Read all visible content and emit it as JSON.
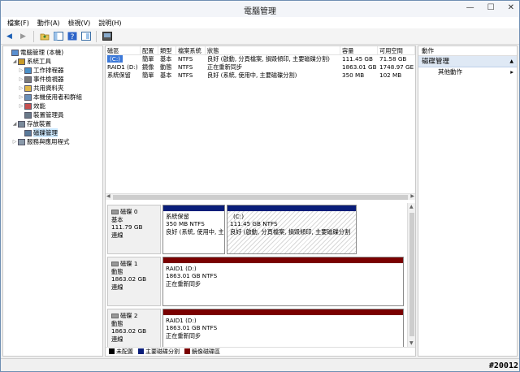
{
  "window": {
    "title": "電腦管理",
    "minimize": "—",
    "maximize": "☐",
    "close": "✕"
  },
  "menu": [
    "檔案(F)",
    "動作(A)",
    "檢視(V)",
    "說明(H)"
  ],
  "toolbar": [
    "back-arrow-icon",
    "forward-arrow-icon",
    "up-folder-icon",
    "show-tree-icon",
    "help-icon",
    "properties-icon",
    "console-icon"
  ],
  "tree": [
    {
      "label": "電腦管理 (本機)",
      "level": 0,
      "expander": "",
      "icon": "computer-icon"
    },
    {
      "label": "系統工具",
      "level": 1,
      "expander": "◢",
      "icon": "tools-icon"
    },
    {
      "label": "工作排程器",
      "level": 2,
      "expander": "▷",
      "icon": "scheduler-icon"
    },
    {
      "label": "事件檢視器",
      "level": 2,
      "expander": "▷",
      "icon": "event-viewer-icon"
    },
    {
      "label": "共用資料夾",
      "level": 2,
      "expander": "▷",
      "icon": "shared-folder-icon"
    },
    {
      "label": "本機使用者和群組",
      "level": 2,
      "expander": "▷",
      "icon": "users-icon"
    },
    {
      "label": "效能",
      "level": 2,
      "expander": "▷",
      "icon": "performance-icon"
    },
    {
      "label": "裝置管理員",
      "level": 2,
      "expander": "",
      "icon": "device-manager-icon"
    },
    {
      "label": "存放裝置",
      "level": 1,
      "expander": "◢",
      "icon": "storage-icon"
    },
    {
      "label": "磁碟管理",
      "level": 2,
      "expander": "",
      "icon": "disk-management-icon",
      "selected": true
    },
    {
      "label": "服務與應用程式",
      "level": 1,
      "expander": "▷",
      "icon": "services-icon"
    }
  ],
  "grid": {
    "headers": [
      "磁區",
      "配置",
      "類型",
      "檔案系統",
      "狀態",
      "容量",
      "可用空間"
    ],
    "rows": [
      [
        "(C:)",
        "簡單",
        "基本",
        "NTFS",
        "良好 (啟動, 分頁檔案, 損毀傾印, 主要磁碟分割)",
        "111.45 GB",
        "71.58 GB"
      ],
      [
        "RAID1 (D:)",
        "鏡像",
        "動態",
        "NTFS",
        "正在重新同步",
        "1863.01 GB",
        "1748.97 GE"
      ],
      [
        "系統保留",
        "簡單",
        "基本",
        "NTFS",
        "良好 (系統, 使用中, 主要磁碟分割)",
        "350 MB",
        "102 MB"
      ]
    ]
  },
  "disks": [
    {
      "name": "磁碟 0",
      "type": "基本",
      "size": "111.79 GB",
      "status": "連線",
      "partitions": [
        {
          "title": "系統保留",
          "line2": "350 MB NTFS",
          "line3": "良好 (系統, 使用中, 主",
          "line4": "",
          "bar": "#0a1e7a",
          "hatched": false
        },
        {
          "title": "(C:)",
          "line2": "111.45 GB NTFS",
          "line3": "良好 (啟動, 分頁檔案, 損毀傾印, 主要磁碟分割",
          "line4": "",
          "bar": "#0a1e7a",
          "hatched": true
        }
      ]
    },
    {
      "name": "磁碟 1",
      "type": "動態",
      "size": "1863.02 GB",
      "status": "連線",
      "partitions": [
        {
          "title": "RAID1 (D:)",
          "line2": "1863.01 GB NTFS",
          "line3": "正在重新同步",
          "line4": "",
          "bar": "#7a0000",
          "hatched": false
        }
      ]
    },
    {
      "name": "磁碟 2",
      "type": "動態",
      "size": "1863.02 GB",
      "status": "連線",
      "partitions": [
        {
          "title": "RAID1 (D:)",
          "line2": "1863.01 GB NTFS",
          "line3": "正在重新同步",
          "line4": "",
          "bar": "#7a0000",
          "hatched": false
        }
      ]
    }
  ],
  "legend": [
    {
      "label": "未配置",
      "color": "#000000"
    },
    {
      "label": "主要磁碟分割",
      "color": "#0a1e7a"
    },
    {
      "label": "鏡像磁碟區",
      "color": "#7a0000"
    }
  ],
  "actions": {
    "header": "動作",
    "section": "磁碟管理",
    "section_arrow": "▲",
    "item": "其他動作",
    "item_arrow": "▸"
  },
  "watermark": "#20012"
}
